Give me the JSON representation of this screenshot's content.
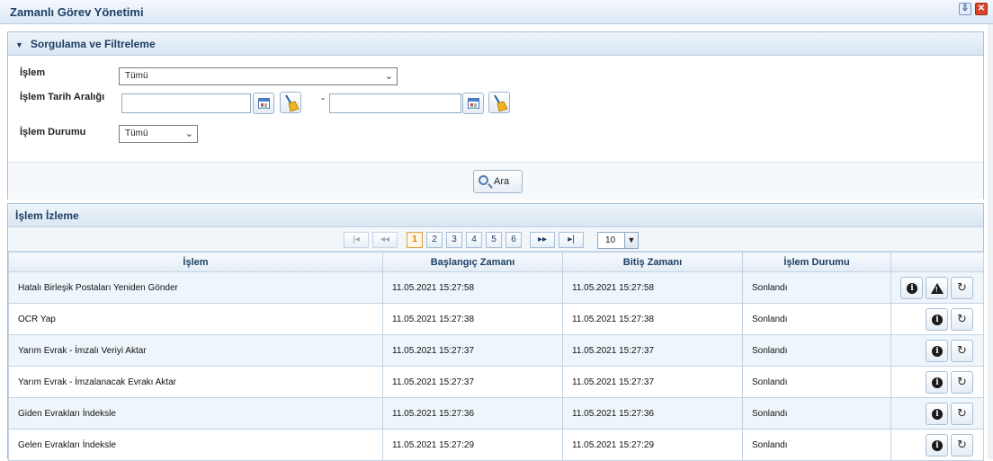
{
  "window": {
    "title": "Zamanlı Görev Yönetimi"
  },
  "filter": {
    "header": "Sorgulama ve Filtreleme",
    "islem_label": "İşlem",
    "islem_value": "Tümü",
    "tarih_label": "İşlem Tarih Aralığı",
    "tarih_separator": "-",
    "tarih_start": "",
    "tarih_end": "",
    "durum_label": "İşlem Durumu",
    "durum_value": "Tümü",
    "search_label": "Ara"
  },
  "monitor": {
    "header": "İşlem İzleme",
    "pager": {
      "first": "|◂",
      "prev": "◂◂",
      "pages": [
        "1",
        "2",
        "3",
        "4",
        "5",
        "6"
      ],
      "current": "1",
      "next": "▸▸",
      "last": "▸|",
      "page_size": "10"
    },
    "columns": [
      "İşlem",
      "Başlangıç Zamanı",
      "Bitiş Zamanı",
      "İşlem Durumu",
      ""
    ],
    "rows": [
      {
        "islem": "Hatalı Birleşik Postaları Yeniden Gönder",
        "baslangic": "11.05.2021 15:27:58",
        "bitis": "11.05.2021 15:27:58",
        "durum": "Sonlandı"
      },
      {
        "islem": "OCR Yap",
        "baslangic": "11.05.2021 15:27:38",
        "bitis": "11.05.2021 15:27:38",
        "durum": "Sonlandı"
      },
      {
        "islem": "Yarım Evrak - İmzalı Veriyi Aktar",
        "baslangic": "11.05.2021 15:27:37",
        "bitis": "11.05.2021 15:27:37",
        "durum": "Sonlandı"
      },
      {
        "islem": "Yarım Evrak - İmzalanacak Evrakı Aktar",
        "baslangic": "11.05.2021 15:27:37",
        "bitis": "11.05.2021 15:27:37",
        "durum": "Sonlandı"
      },
      {
        "islem": "Giden Evrakları İndeksle",
        "baslangic": "11.05.2021 15:27:36",
        "bitis": "11.05.2021 15:27:36",
        "durum": "Sonlandı"
      },
      {
        "islem": "Gelen Evrakları İndeksle",
        "baslangic": "11.05.2021 15:27:29",
        "bitis": "11.05.2021 15:27:29",
        "durum": "Sonlandı"
      }
    ]
  },
  "colors": {
    "header_text": "#1d3f63",
    "close_button": "#d8452d",
    "active_page": "#e07b00",
    "row_alt": "#eef6fb"
  }
}
